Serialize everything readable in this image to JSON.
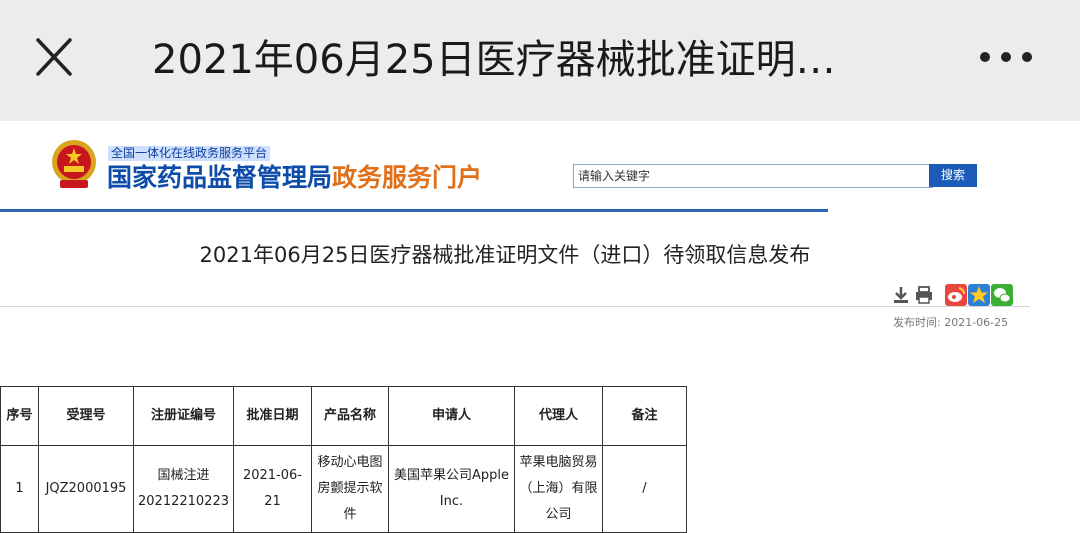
{
  "topbar": {
    "title": "2021年06月25日医疗器械批准证明…"
  },
  "header": {
    "platform_label": "全国一体化在线政务服务平台",
    "site_name": "国家药品监督管理局",
    "site_suffix": "政务服务门户",
    "search_placeholder": "请输入关键字",
    "search_button": "搜索"
  },
  "article": {
    "title": "2021年06月25日医疗器械批准证明文件（进口）待领取信息发布",
    "publish_label": "发布时间:",
    "publish_date": "2021-06-25"
  },
  "table": {
    "headers": [
      "序号",
      "受理号",
      "注册证编号",
      "批准日期",
      "产品名称",
      "申请人",
      "代理人",
      "备注"
    ],
    "rows": [
      [
        "1",
        "JQZ2000195",
        "国械注进20212210223",
        "2021-06-21",
        "移动心电图房颤提示软件",
        "美国苹果公司Apple Inc.",
        "苹果电脑贸易（上海）有限公司",
        "/"
      ]
    ]
  },
  "colors": {
    "brand_blue": "#0d4ca8",
    "brand_orange": "#e0701a",
    "search_button": "#1c5cb8",
    "topbar_bg": "#ececec"
  },
  "icons": [
    "close-icon",
    "more-icon",
    "emblem-icon",
    "download-icon",
    "print-icon",
    "weibo-icon",
    "qzone-icon",
    "wechat-icon"
  ]
}
